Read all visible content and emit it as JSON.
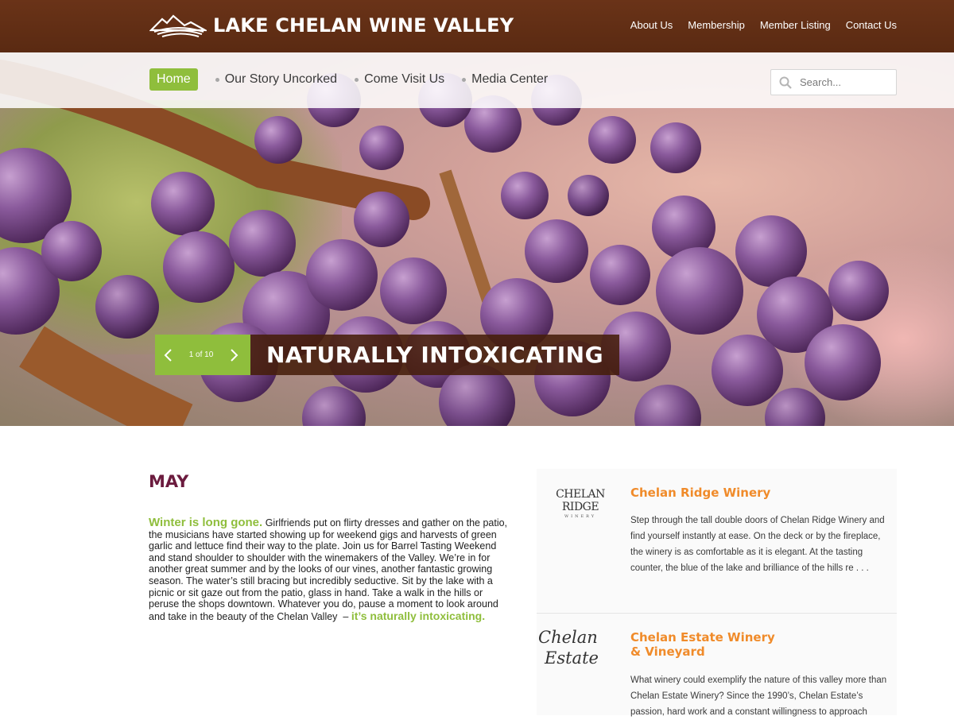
{
  "header": {
    "site_title": "LAKE CHELAN WINE VALLEY",
    "top_links": [
      "About Us",
      "Membership",
      "Member Listing",
      "Contact Us"
    ]
  },
  "subnav": {
    "home": "Home",
    "items": [
      "Our Story Uncorked",
      "Come Visit Us",
      "Media Center"
    ],
    "search_placeholder": "Search..."
  },
  "hero": {
    "counter": "1 of 10",
    "caption": "NATURALLY INTOXICATING"
  },
  "content": {
    "month": "MAY",
    "lead": "Winter is long gone.",
    "body": "Girlfriends put on flirty dresses and gather on the patio, the musicians have started showing up for weekend gigs and harvests of green garlic and lettuce find their way to the plate. Join us for Barrel Tasting Weekend and stand shoulder to shoulder with the winemakers of the Valley. We’re in for another great summer and by the looks of our vines, another fantastic growing season. The water’s still bracing but incredibly seductive. Sit by the lake with a picnic or sit gaze out from the patio, glass in hand. Take a walk in the hills or peruse the shops downtown. Whatever you do, pause a moment to look around and take in the beauty of the Chelan Valley",
    "dash": "–",
    "tail": "it’s naturally intoxicating."
  },
  "wineries": [
    {
      "logo_text": "CHELAN RIDGE",
      "logo_sub": "WINERY",
      "name": "Chelan Ridge Winery",
      "description": "Step through the tall double doors of Chelan Ridge Winery and find yourself instantly at ease. On the deck or by the fireplace, the winery is as comfortable as it is elegant. At the tasting counter, the blue of the lake and brilliance of the hills re . . ."
    },
    {
      "logo_line1": "Chelan",
      "logo_line2": "Estate",
      "name_line1": "Chelan Estate Winery",
      "name_line2": "& Vineyard",
      "description": "What winery could exemplify the nature of this valley more than Chelan Estate Winery? Since the 1990’s, Chelan Estate’s passion, hard work and a constant willingness to approach"
    }
  ],
  "colors": {
    "header_brown": "#5a2a12",
    "accent_green": "#8fbe3c",
    "winery_orange": "#f08b2a",
    "month_plum": "#6b1b3e"
  }
}
